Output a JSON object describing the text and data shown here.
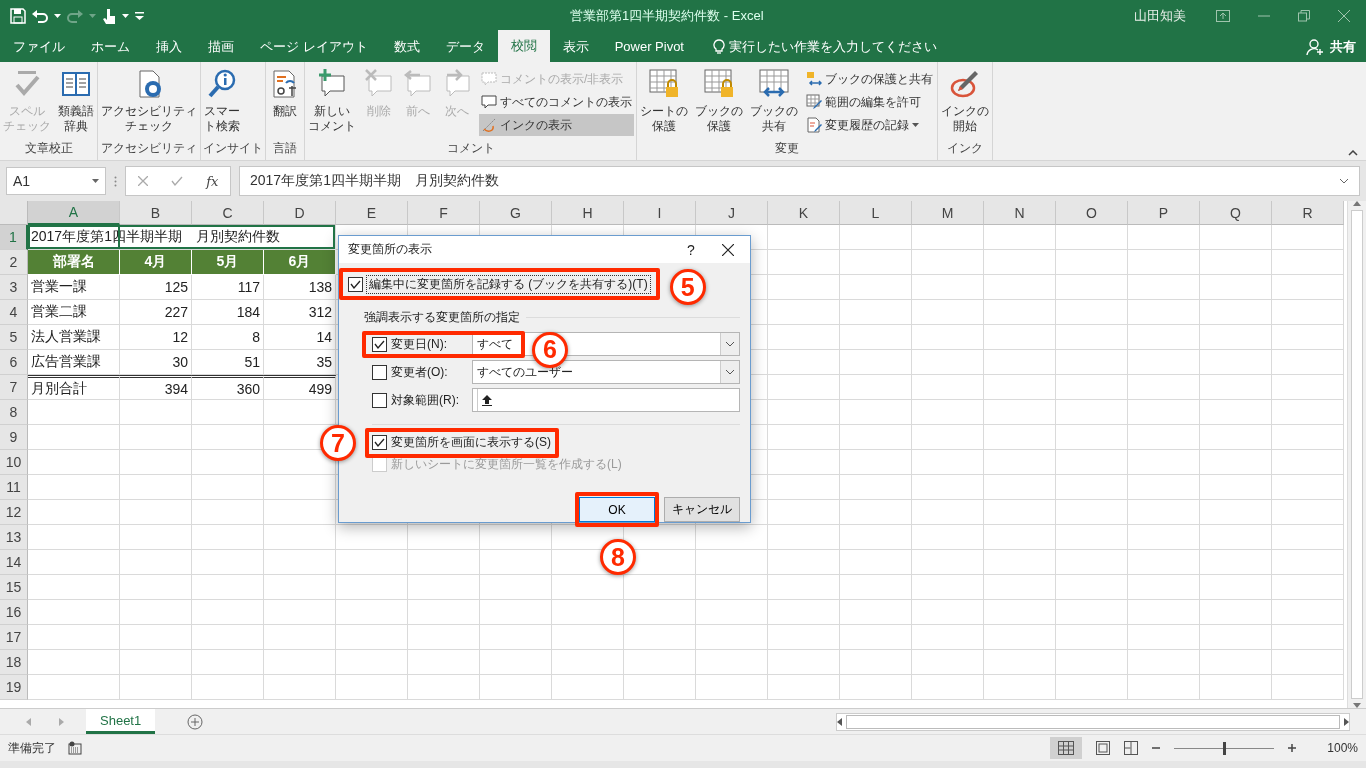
{
  "title_bar": {
    "title": "営業部第1四半期契約件数  -  Excel",
    "user": "山田知美"
  },
  "tabs": [
    {
      "label": "ファイル",
      "selected": false
    },
    {
      "label": "ホーム",
      "selected": false
    },
    {
      "label": "挿入",
      "selected": false
    },
    {
      "label": "描画",
      "selected": false
    },
    {
      "label": "ページ レイアウト",
      "selected": false
    },
    {
      "label": "数式",
      "selected": false
    },
    {
      "label": "データ",
      "selected": false
    },
    {
      "label": "校閲",
      "selected": true
    },
    {
      "label": "表示",
      "selected": false
    },
    {
      "label": "Power Pivot",
      "selected": false
    }
  ],
  "tell_me": "実行したい作業を入力してください",
  "share": "共有",
  "ribbon_groups": [
    {
      "label": "文章校正",
      "buttons": [
        {
          "lines": [
            "スペル",
            "チェック"
          ],
          "disabled": true
        },
        {
          "lines": [
            "類義語",
            "辞典"
          ],
          "disabled": false
        }
      ]
    },
    {
      "label": "アクセシビリティ",
      "buttons": [
        {
          "lines": [
            "アクセシビリティ",
            "チェック"
          ],
          "disabled": false
        }
      ]
    },
    {
      "label": "インサイト",
      "buttons": [
        {
          "lines": [
            "スマー",
            "ト検索"
          ],
          "disabled": false
        }
      ]
    },
    {
      "label": "言語",
      "buttons": [
        {
          "lines": [
            "翻訳"
          ],
          "disabled": false
        }
      ]
    },
    {
      "label": "コメント",
      "buttons": [
        {
          "lines": [
            "新しい",
            "コメント"
          ],
          "disabled": false
        },
        {
          "lines": [
            "削除"
          ],
          "disabled": true
        },
        {
          "lines": [
            "前へ"
          ],
          "disabled": true
        },
        {
          "lines": [
            "次へ"
          ],
          "disabled": true
        }
      ],
      "small_buttons": [
        {
          "label": "コメントの表示/非表示",
          "disabled": true,
          "on": false
        },
        {
          "label": "すべてのコメントの表示",
          "disabled": false,
          "on": false
        },
        {
          "label": "インクの表示",
          "disabled": false,
          "on": true
        }
      ]
    },
    {
      "label": "変更",
      "buttons": [
        {
          "lines": [
            "シートの",
            "保護"
          ],
          "disabled": false
        },
        {
          "lines": [
            "ブックの",
            "保護"
          ],
          "disabled": false
        },
        {
          "lines": [
            "ブックの",
            "共有"
          ],
          "disabled": false
        }
      ],
      "small_buttons": [
        {
          "label": "ブックの保護と共有",
          "disabled": false,
          "on": false
        },
        {
          "label": "範囲の編集を許可",
          "disabled": false,
          "on": false
        },
        {
          "label": "変更履歴の記録",
          "disabled": false,
          "on": false,
          "dropdown": true
        }
      ]
    },
    {
      "label": "インク",
      "buttons": [
        {
          "lines": [
            "インクの",
            "開始"
          ],
          "disabled": false
        }
      ]
    }
  ],
  "formula_bar": {
    "name_box": "A1",
    "function_label": "fx",
    "formula": "2017年度第1四半期半期　月別契約件数"
  },
  "sheet": {
    "columns": [
      {
        "label": "A",
        "selected": true
      },
      {
        "label": "B",
        "selected": false
      },
      {
        "label": "C",
        "selected": false
      },
      {
        "label": "D",
        "selected": false
      },
      {
        "label": "E",
        "selected": false
      },
      {
        "label": "F",
        "selected": false
      },
      {
        "label": "G",
        "selected": false
      },
      {
        "label": "H",
        "selected": false
      },
      {
        "label": "I",
        "selected": false
      },
      {
        "label": "J",
        "selected": false
      },
      {
        "label": "K",
        "selected": false
      },
      {
        "label": "L",
        "selected": false
      },
      {
        "label": "M",
        "selected": false
      },
      {
        "label": "N",
        "selected": false
      },
      {
        "label": "O",
        "selected": false
      },
      {
        "label": "P",
        "selected": false
      },
      {
        "label": "Q",
        "selected": false
      },
      {
        "label": "R",
        "selected": false
      }
    ],
    "rows": [
      {
        "label": "1",
        "selected": true,
        "kind": "title",
        "cells": [
          "2017年度第1四半期半期　月別契約件数"
        ]
      },
      {
        "label": "2",
        "selected": false,
        "kind": "header",
        "cells": [
          "部署名",
          "4月",
          "5月",
          "6月"
        ]
      },
      {
        "label": "3",
        "selected": false,
        "kind": "data",
        "cells": [
          "営業一課",
          "125",
          "117",
          "138"
        ]
      },
      {
        "label": "4",
        "selected": false,
        "kind": "data",
        "cells": [
          "営業二課",
          "227",
          "184",
          "312"
        ]
      },
      {
        "label": "5",
        "selected": false,
        "kind": "data",
        "cells": [
          "法人営業課",
          "12",
          "8",
          "14"
        ]
      },
      {
        "label": "6",
        "selected": false,
        "kind": "data",
        "cells": [
          "広告営業課",
          "30",
          "51",
          "35"
        ]
      },
      {
        "label": "7",
        "selected": false,
        "kind": "total",
        "cells": [
          "月別合計",
          "394",
          "360",
          "499"
        ]
      },
      {
        "label": "8",
        "selected": false
      },
      {
        "label": "9",
        "selected": false
      },
      {
        "label": "10",
        "selected": false
      },
      {
        "label": "11",
        "selected": false
      },
      {
        "label": "12",
        "selected": false
      },
      {
        "label": "13",
        "selected": false
      },
      {
        "label": "14",
        "selected": false
      },
      {
        "label": "15",
        "selected": false
      },
      {
        "label": "16",
        "selected": false
      },
      {
        "label": "17",
        "selected": false
      },
      {
        "label": "18",
        "selected": false
      },
      {
        "label": "19",
        "selected": false
      }
    ]
  },
  "sheet_tabs": [
    {
      "label": "Sheet1",
      "selected": true
    }
  ],
  "status_bar": {
    "status": "準備完了",
    "zoom": {
      "label": "100%",
      "level": 0.5
    }
  },
  "dialog": {
    "title": "変更箇所の表示",
    "help": "?",
    "record": {
      "label": "編集中に変更箇所を記録する (ブックを共有する)(T)",
      "checked": true
    },
    "section": "強調表示する変更箇所の指定",
    "filters": [
      {
        "kind": "dropdown",
        "label": "変更日(N):",
        "checked": true,
        "value": "すべて"
      },
      {
        "kind": "dropdown",
        "label": "変更者(O):",
        "checked": false,
        "value": "すべてのユーザー"
      },
      {
        "kind": "range",
        "label": "対象範囲(R):",
        "checked": false
      }
    ],
    "options": [
      {
        "label": "変更箇所を画面に表示する(S)",
        "checked": true,
        "disabled": false
      },
      {
        "label": "新しいシートに変更箇所一覧を作成する(L)",
        "checked": false,
        "disabled": true
      }
    ],
    "buttons": [
      {
        "label": "OK",
        "default": true
      },
      {
        "label": "キャンセル",
        "default": false
      }
    ]
  },
  "annotations": [
    {
      "number": "5"
    },
    {
      "number": "6"
    },
    {
      "number": "7"
    },
    {
      "number": "8"
    }
  ]
}
